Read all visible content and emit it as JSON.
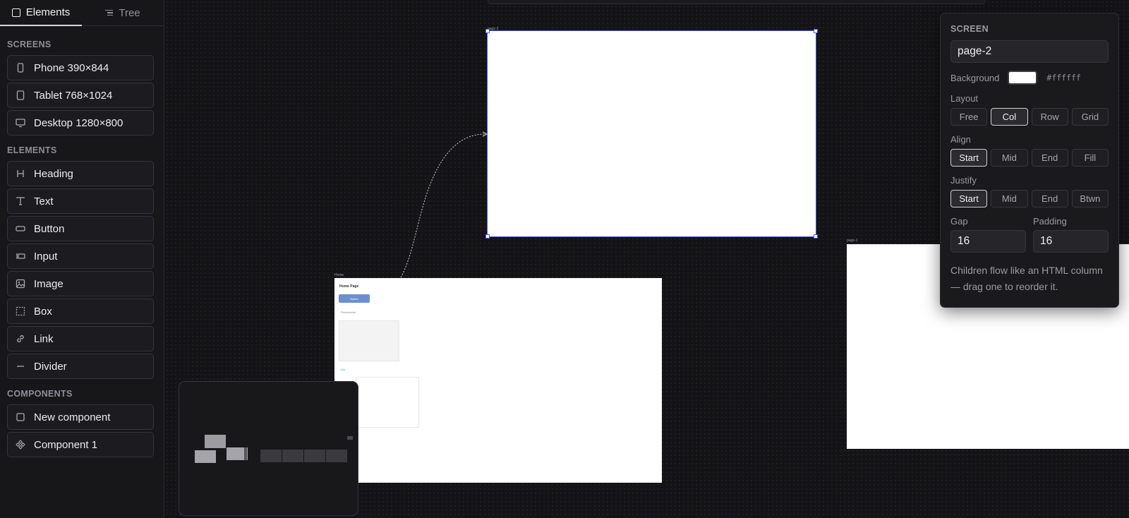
{
  "sidebar": {
    "tabs": [
      {
        "label": "Elements",
        "icon": "square-icon"
      },
      {
        "label": "Tree",
        "icon": "tree-list-icon"
      }
    ],
    "sections": {
      "screens": "SCREENS",
      "elements": "ELEMENTS",
      "components": "COMPONENTS"
    },
    "screens": [
      {
        "label": "Phone 390×844",
        "icon": "phone-icon"
      },
      {
        "label": "Tablet 768×1024",
        "icon": "tablet-icon"
      },
      {
        "label": "Desktop 1280×800",
        "icon": "monitor-icon"
      }
    ],
    "elements": [
      {
        "label": "Heading",
        "icon": "heading-icon"
      },
      {
        "label": "Text",
        "icon": "text-icon"
      },
      {
        "label": "Button",
        "icon": "button-icon"
      },
      {
        "label": "Input",
        "icon": "input-icon"
      },
      {
        "label": "Image",
        "icon": "image-icon"
      },
      {
        "label": "Box",
        "icon": "box-icon"
      },
      {
        "label": "Link",
        "icon": "link-icon"
      },
      {
        "label": "Divider",
        "icon": "divider-icon"
      }
    ],
    "components": [
      {
        "label": "New component",
        "icon": "square-icon"
      },
      {
        "label": "Component 1",
        "icon": "component-icon"
      }
    ]
  },
  "canvas": {
    "screens": {
      "page2": {
        "tag": "page-2"
      },
      "home": {
        "tag": "Home",
        "title": "Home Page",
        "button": "Button",
        "placeholder": "Placeholder",
        "link": "Link"
      },
      "page1": {
        "tag": "page-1"
      }
    }
  },
  "panel": {
    "heading": "SCREEN",
    "name_value": "page-2",
    "background_label": "Background",
    "background_color": "#ffffff",
    "background_hex": "#ffffff",
    "layout_label": "Layout",
    "layout_options": [
      "Free",
      "Col",
      "Row",
      "Grid"
    ],
    "layout_selected": "Col",
    "align_label": "Align",
    "align_options": [
      "Start",
      "Mid",
      "End",
      "Fill"
    ],
    "align_selected": "Start",
    "justify_label": "Justify",
    "justify_options": [
      "Start",
      "Mid",
      "End",
      "Btwn"
    ],
    "justify_selected": "Start",
    "gap_label": "Gap",
    "gap_value": "16",
    "padding_label": "Padding",
    "padding_value": "16",
    "hint": "Children flow like an HTML column — drag one to reorder it."
  },
  "colors": {
    "canvas_bg": "#141417",
    "selection": "#4a5bd4",
    "mini_button": "#6b8fd0"
  }
}
